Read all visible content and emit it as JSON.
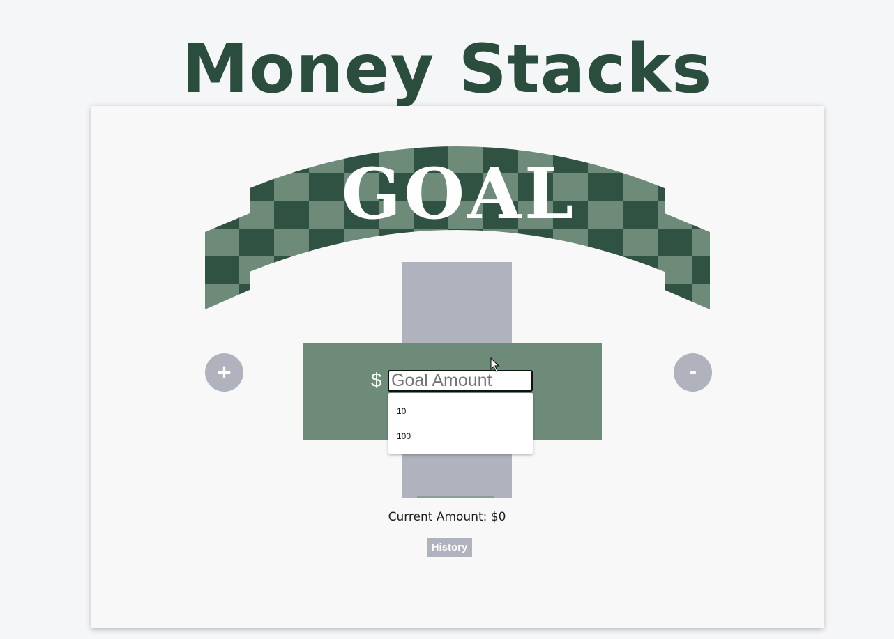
{
  "app": {
    "title": "Money Stacks"
  },
  "banner": {
    "text": "GOAL",
    "colors": {
      "dark": "#2f5242",
      "light": "#6e8b7a"
    }
  },
  "goal": {
    "currency_symbol": "$",
    "input_value": "",
    "input_placeholder": "Goal Amount",
    "suggestions": [
      "10",
      "100"
    ]
  },
  "controls": {
    "add_label": "+",
    "subtract_label": "-"
  },
  "status": {
    "current_amount_text": "Current Amount: $0"
  },
  "history": {
    "button_label": "History"
  },
  "colors": {
    "title": "#2a4d3e",
    "button_gray": "#b0b3be",
    "bill_green": "#6e8b7a",
    "background": "#f5f6f8",
    "card": "#f8f8f8"
  },
  "icons": {
    "pointer": "mouse-pointer-icon"
  }
}
